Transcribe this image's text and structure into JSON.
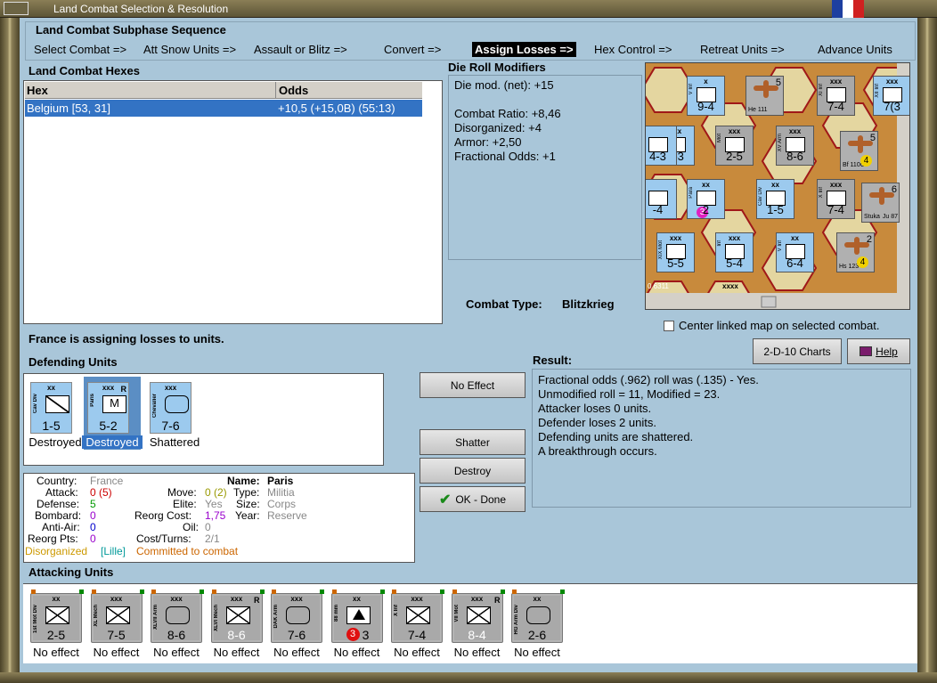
{
  "window": {
    "title": "Land Combat Selection & Resolution"
  },
  "subphase": {
    "header": "Land Combat Subphase Sequence",
    "steps": [
      "Select Combat =>",
      "Att Snow Units =>",
      "Assault or Blitz =>",
      "Convert =>",
      "Assign Losses =>",
      "Hex Control =>",
      "Retreat Units =>",
      "Advance Units"
    ],
    "active": "Assign Losses =>"
  },
  "hexes": {
    "header": "Land Combat Hexes",
    "columns": [
      "Hex",
      "Odds"
    ],
    "rows": [
      {
        "hex": "Belgium [53, 31]",
        "odds": "+10,5 (+15,0B) (55:13)"
      }
    ]
  },
  "modifiers": {
    "header": "Die Roll Modifiers",
    "lines": [
      "Die mod. (net): +15",
      "",
      "Combat Ratio: +8,46",
      "Disorganized: +4",
      "Armor: +2,50",
      "Fractional Odds: +1"
    ]
  },
  "combat_type": {
    "label": "Combat Type:",
    "value": "Blitzkrieg"
  },
  "center_map": {
    "label": "Center linked map on selected combat.",
    "checked": false
  },
  "buttons": {
    "charts": "2-D-10 Charts",
    "help": "Help",
    "no_effect": "No Effect",
    "shatter": "Shatter",
    "destroy": "Destroy",
    "ok_done": "OK - Done"
  },
  "status": "France is assigning losses to units.",
  "defending": {
    "header": "Defending Units",
    "units": [
      {
        "name": "Cav Div",
        "size": "xx",
        "value": "1-5",
        "status": "Destroyed",
        "selected": false,
        "reserve": ""
      },
      {
        "name": "Paris",
        "size": "xxx",
        "value": "5-2",
        "status": "Destroyed",
        "selected": true,
        "reserve": "R",
        "mark": "M"
      },
      {
        "name": "Chevalier",
        "size": "xxx",
        "value": "7-6",
        "status": "Shattered",
        "selected": false,
        "reserve": ""
      }
    ]
  },
  "result": {
    "header": "Result:",
    "lines": [
      "Fractional odds (.962) roll was (.135)  - Yes.",
      "Unmodified roll = 11, Modified = 23.",
      "Attacker loses 0 units.",
      "Defender loses 2 units.",
      "Defending units are shattered.",
      "A breakthrough occurs."
    ]
  },
  "info": {
    "country_label": "Country:",
    "country": "France",
    "attack_label": "Attack:",
    "attack": "0",
    "attack_paren": "(5)",
    "defense_label": "Defense:",
    "defense": "5",
    "bombard_label": "Bombard:",
    "bombard": "0",
    "antiair_label": "Anti-Air:",
    "antiair": "0",
    "reorgpts_label": "Reorg Pts:",
    "reorgpts": "0",
    "move_label": "Move:",
    "move": "0",
    "move_paren": "(2)",
    "elite_label": "Elite:",
    "elite": "Yes",
    "reorgcost_label": "Reorg Cost:",
    "reorgcost": "1,75",
    "oil_label": "Oil:",
    "oil": "0",
    "costturns_label": "Cost/Turns:",
    "costturns": "2/1",
    "name_label": "Name:",
    "name": "Paris",
    "type_label": "Type:",
    "type": "Militia",
    "size_label": "Size:",
    "size": "Corps",
    "year_label": "Year:",
    "year": "Reserve",
    "disorganized": "Disorganized",
    "location": "[Lille]",
    "committed": "Committed to combat"
  },
  "attacking": {
    "header": "Attacking Units",
    "units": [
      {
        "name": "1st Mot Div",
        "size": "xx",
        "value": "2-5",
        "status": "No effect",
        "reserve": ""
      },
      {
        "name": "XL Mech",
        "size": "xxx",
        "value": "7-5",
        "status": "No effect",
        "reserve": ""
      },
      {
        "name": "XLVII Arm",
        "size": "xxx",
        "value": "8-6",
        "status": "No effect",
        "reserve": ""
      },
      {
        "name": "XLVI Mech",
        "size": "xxx",
        "value": "8-6",
        "status": "No effect",
        "reserve": "R"
      },
      {
        "name": "DAK Arm",
        "size": "xxx",
        "value": "7-6",
        "status": "No effect",
        "reserve": ""
      },
      {
        "name": "88 mm",
        "size": "xx",
        "value": "3",
        "status": "No effect",
        "reserve": "",
        "badge": "3"
      },
      {
        "name": "X Inf",
        "size": "xxx",
        "value": "7-4",
        "status": "No effect",
        "reserve": ""
      },
      {
        "name": "VII Mot",
        "size": "xxx",
        "value": "8-4",
        "status": "No effect",
        "reserve": "R"
      },
      {
        "name": "HG Arm Div",
        "size": "xx",
        "value": "2-6",
        "status": "No effect",
        "reserve": ""
      }
    ]
  },
  "map_units": [
    {
      "label": "9-4",
      "size": "x",
      "name": "V Inf"
    },
    {
      "label": "7-4",
      "size": "xxx",
      "name": "XI Inf"
    },
    {
      "label": "7(3",
      "size": "xxx",
      "name": "XII Inf"
    },
    {
      "label": "4-3",
      "size": "xxx",
      "name": "XVI Inf"
    },
    {
      "label": "2-5",
      "size": "xxx",
      "name": "Mot"
    },
    {
      "label": "8-6",
      "size": "xxx",
      "name": "XV Arm"
    },
    {
      "label": "2",
      "size": "xx",
      "name": "Para",
      "badge": "3"
    },
    {
      "label": "1-5",
      "size": "xx",
      "name": "Cav Div"
    },
    {
      "label": "7-4",
      "size": "xxx",
      "name": "X Inf"
    },
    {
      "label": "5-5",
      "size": "xxx",
      "name": "XIX Mot"
    },
    {
      "label": "5-4",
      "size": "xxx",
      "name": "Inf"
    },
    {
      "label": "6-4",
      "size": "xx",
      "name": "V Inf"
    },
    {
      "label": "4-3",
      "size": "",
      "name": ""
    },
    {
      "label": "-4",
      "size": "",
      "name": ""
    }
  ],
  "map_aircraft": [
    {
      "name": "He 111",
      "number": "5"
    },
    {
      "name": "Bf 110C",
      "number": "5",
      "badge": "4"
    },
    {
      "name": "Stuka",
      "number": "6",
      "model": "Ju 87"
    },
    {
      "name": "Hs 123",
      "number": "2",
      "badge": "4"
    }
  ],
  "map_text": [
    "0 6311",
    "xxxx"
  ],
  "colors": {
    "panel": "#a9c6d9",
    "selection": "#3373c4",
    "unit_blue": "#9ccaee",
    "unit_grey": "#a8a8a8",
    "orange": "#cc6600",
    "green": "#009900",
    "purple": "#9900cc",
    "blue": "#0000cc",
    "red": "#cc0000"
  }
}
